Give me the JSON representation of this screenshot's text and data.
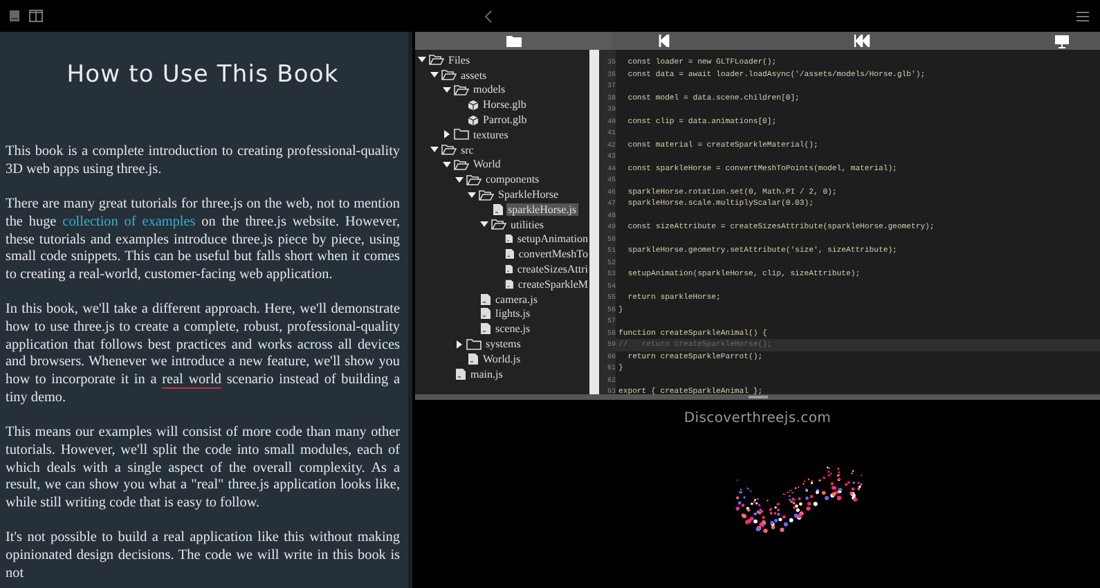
{
  "book": {
    "title": "How to Use This Book",
    "paragraphs": [
      [
        {
          "kind": "plain",
          "text": "This book is a complete introduction to creating professional-quality 3D web apps using three.js."
        }
      ],
      [
        {
          "kind": "plain",
          "text": "There are many great tutorials for three.js on the web, not to mention the huge "
        },
        {
          "kind": "link",
          "text": "collection of examples"
        },
        {
          "kind": "plain",
          "text": " on the three.js website. However, these tutorials and examples introduce three.js piece by piece, using small code snippets. This can be useful but falls short when it comes to creating a real-world, customer-facing web application."
        }
      ],
      [
        {
          "kind": "plain",
          "text": "In this book, we'll take a different approach. Here, we'll demonstrate how to use three.js to create a complete, robust, professional-quality application that follows best practices and works across all devices and browsers. Whenever we introduce a new feature, we'll show you how to incorporate it in a "
        },
        {
          "kind": "underline",
          "text": "real world"
        },
        {
          "kind": "plain",
          "text": " scenario instead of building a tiny demo."
        }
      ],
      [
        {
          "kind": "plain",
          "text": "This means our examples will consist of more code than many other tutorials. However, we'll split the code into small modules, each of which deals with a single aspect of the overall complexity. As a result, we can show you what a \"real\" three.js application looks like, while still writing code that is easy to follow."
        }
      ],
      [
        {
          "kind": "plain",
          "text": "It's not possible to build a real application like this without making opinionated design decisions. The code we will write in this book is not"
        }
      ]
    ]
  },
  "file_tree": [
    {
      "label": "Files",
      "kind": "folder",
      "expanded": true,
      "selected": false,
      "children": [
        {
          "label": "assets",
          "kind": "folder",
          "expanded": true,
          "selected": false,
          "children": [
            {
              "label": "models",
              "kind": "folder",
              "expanded": true,
              "selected": false,
              "children": [
                {
                  "label": "Horse.glb",
                  "kind": "model",
                  "selected": false
                },
                {
                  "label": "Parrot.glb",
                  "kind": "model",
                  "selected": false
                }
              ]
            },
            {
              "label": "textures",
              "kind": "folder",
              "expanded": false,
              "selected": false
            }
          ]
        },
        {
          "label": "src",
          "kind": "folder",
          "expanded": true,
          "selected": false,
          "children": [
            {
              "label": "World",
              "kind": "folder",
              "expanded": true,
              "selected": false,
              "children": [
                {
                  "label": "components",
                  "kind": "folder",
                  "expanded": true,
                  "selected": false,
                  "children": [
                    {
                      "label": "SparkleHorse",
                      "kind": "folder",
                      "expanded": true,
                      "selected": false,
                      "children": [
                        {
                          "label": "sparkleHorse.js",
                          "kind": "script",
                          "selected": true
                        },
                        {
                          "label": "utilities",
                          "kind": "folder",
                          "expanded": true,
                          "selected": false,
                          "children": [
                            {
                              "label": "setupAnimation",
                              "kind": "script",
                              "selected": false
                            },
                            {
                              "label": "convertMeshTo",
                              "kind": "script",
                              "selected": false
                            },
                            {
                              "label": "createSizesAttri",
                              "kind": "script",
                              "selected": false
                            },
                            {
                              "label": "createSparkleM",
                              "kind": "script",
                              "selected": false
                            }
                          ]
                        }
                      ]
                    },
                    {
                      "label": "camera.js",
                      "kind": "script",
                      "selected": false
                    },
                    {
                      "label": "lights.js",
                      "kind": "script",
                      "selected": false
                    },
                    {
                      "label": "scene.js",
                      "kind": "script",
                      "selected": false
                    }
                  ]
                },
                {
                  "label": "systems",
                  "kind": "folder",
                  "expanded": false,
                  "selected": false
                },
                {
                  "label": "World.js",
                  "kind": "script",
                  "selected": false
                }
              ]
            },
            {
              "label": "main.js",
              "kind": "script",
              "selected": false
            }
          ]
        }
      ]
    }
  ],
  "code": [
    {
      "number": "35",
      "text": "  const loader = new GLTFLoader();",
      "kind": "code",
      "highlighted": false
    },
    {
      "number": "36",
      "text": "  const data = await loader.loadAsync('/assets/models/Horse.glb');",
      "kind": "code",
      "highlighted": false
    },
    {
      "number": "37",
      "kind": "code",
      "highlighted": false
    },
    {
      "number": "38",
      "text": "  const model = data.scene.children[0];",
      "kind": "code",
      "highlighted": false
    },
    {
      "number": "39",
      "kind": "code",
      "highlighted": false
    },
    {
      "number": "40",
      "text": "  const clip = data.animations[0];",
      "kind": "code",
      "highlighted": false
    },
    {
      "number": "41",
      "kind": "code",
      "highlighted": false
    },
    {
      "number": "42",
      "text": "  const material = createSparkleMaterial();",
      "kind": "code",
      "highlighted": false
    },
    {
      "number": "43",
      "kind": "code",
      "highlighted": false
    },
    {
      "number": "44",
      "text": "  const sparkleHorse = convertMeshToPoints(model, material);",
      "kind": "code",
      "highlighted": false
    },
    {
      "number": "45",
      "kind": "code",
      "highlighted": false
    },
    {
      "number": "46",
      "text": "  sparkleHorse.rotation.set(0, Math.PI / 2, 0);",
      "kind": "code",
      "highlighted": false
    },
    {
      "number": "47",
      "text": "  sparkleHorse.scale.multiplyScalar(0.03);",
      "kind": "code",
      "highlighted": false
    },
    {
      "number": "48",
      "kind": "code",
      "highlighted": false
    },
    {
      "number": "49",
      "text": "  const sizeAttribute = createSizesAttribute(sparkleHorse.geometry);",
      "kind": "code",
      "highlighted": false
    },
    {
      "number": "50",
      "kind": "code",
      "highlighted": false
    },
    {
      "number": "51",
      "text": "  sparkleHorse.geometry.setAttribute('size', sizeAttribute);",
      "kind": "code",
      "highlighted": false
    },
    {
      "number": "52",
      "kind": "code",
      "highlighted": false
    },
    {
      "number": "53",
      "text": "  setupAnimation(sparkleHorse, clip, sizeAttribute);",
      "kind": "code",
      "highlighted": false
    },
    {
      "number": "54",
      "kind": "code",
      "highlighted": false
    },
    {
      "number": "55",
      "text": "  return sparkleHorse;",
      "kind": "code",
      "highlighted": false
    },
    {
      "number": "56",
      "text": "}",
      "kind": "code",
      "highlighted": false
    },
    {
      "number": "57",
      "kind": "code",
      "highlighted": false
    },
    {
      "number": "58",
      "text": "function createSparkleAnimal() {",
      "kind": "code",
      "highlighted": false
    },
    {
      "number": "59",
      "text": "//   return createSparkleHorse();",
      "kind": "comment",
      "highlighted": true
    },
    {
      "number": "60",
      "text": "  return createSparkleParrot();",
      "kind": "code",
      "highlighted": false
    },
    {
      "number": "61",
      "text": "}",
      "kind": "code",
      "highlighted": false
    },
    {
      "number": "62",
      "kind": "code",
      "highlighted": false
    },
    {
      "number": "63",
      "text": "export { createSparkleAnimal };",
      "kind": "code",
      "highlighted": false
    }
  ],
  "preview": {
    "caption": "Discoverthreejs.com"
  }
}
